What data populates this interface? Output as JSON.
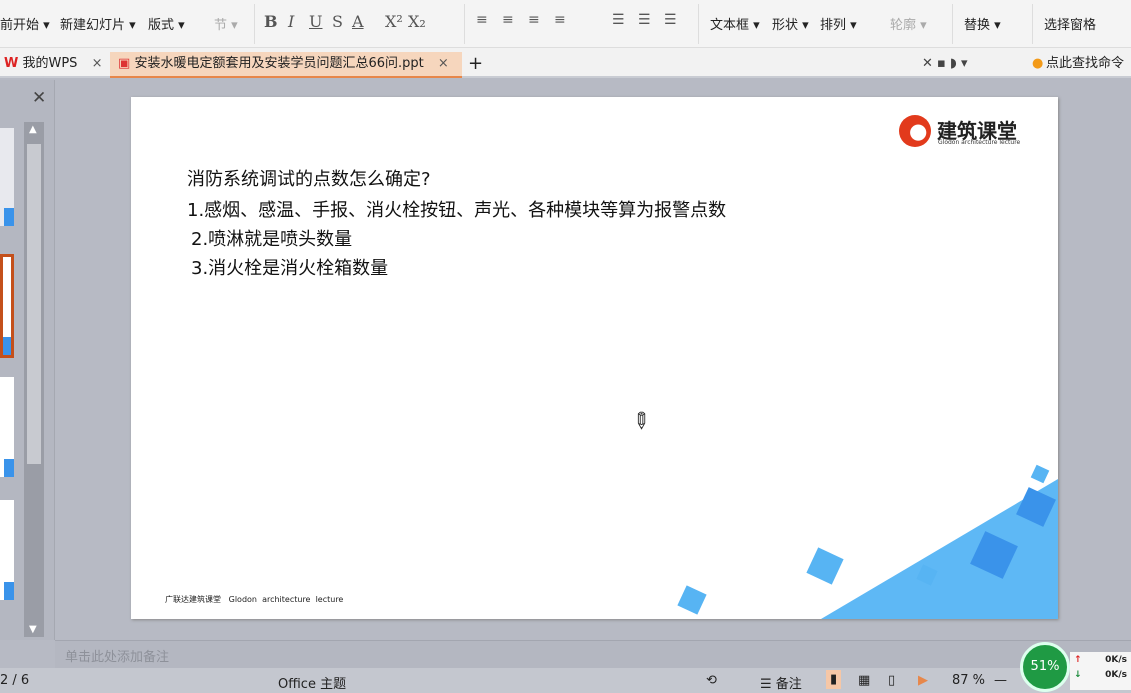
{
  "ribbon": {
    "home": "前开始 ▾",
    "new_slide": "新建幻灯片 ▾",
    "layout": "版式 ▾",
    "section": "节 ▾",
    "bold": "B",
    "italic": "I",
    "underline": "U",
    "strike": "S",
    "font_color": "A",
    "superscript": "X²",
    "subscript": "X₂",
    "textbox": "文本框 ▾",
    "shape": "形状 ▾",
    "arrange": "排列 ▾",
    "outline": "轮廓 ▾",
    "replace": "替换 ▾",
    "select_pane": "选择窗格"
  },
  "tabs": [
    {
      "label": "我的WPS"
    },
    {
      "label": "安装水暖电定额套用及安装学员问题汇总66问.ppt"
    }
  ],
  "search_command": "点此查找命令",
  "slide": {
    "logo_text": "建筑课堂",
    "logo_sub": "Glodon architecture lecture",
    "lines": [
      "消防系统调试的点数怎么确定?",
      "1.感烟、感温、手报、消火栓按钮、声光、各种模块等算为报警点数",
      "2.喷淋就是喷头数量",
      "3.消火栓是消火栓箱数量"
    ],
    "footer": "广联达建筑课堂   Glodon  architecture  lecture",
    "accent": "#3a93ea"
  },
  "notes_placeholder": "单击此处添加备注",
  "status": {
    "page": "2 / 6",
    "theme": "Office 主题",
    "notes": "备注",
    "zoom": "87 %",
    "cpu": "51%",
    "up": "0K/s",
    "down": "0K/s"
  }
}
